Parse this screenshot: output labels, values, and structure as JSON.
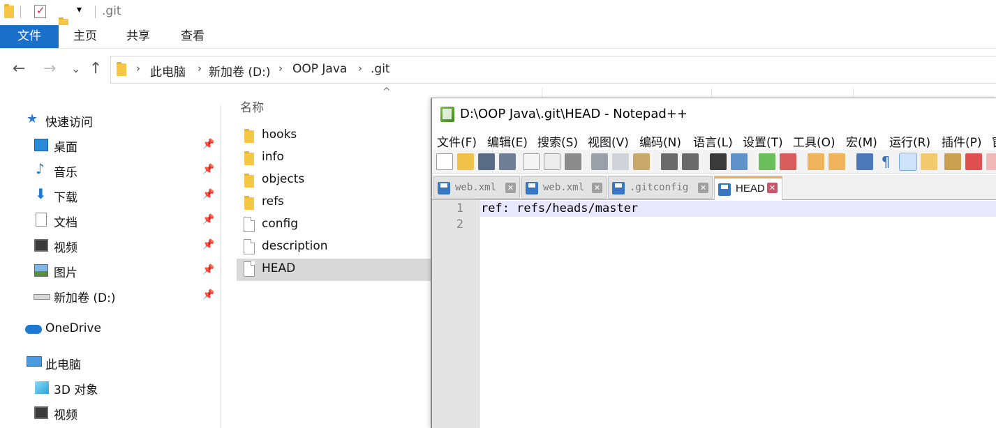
{
  "titlebar": {
    "path_title": ".git"
  },
  "ribbon": {
    "tabs": [
      {
        "label": "文件",
        "active": true
      },
      {
        "label": "主页",
        "active": false
      },
      {
        "label": "共享",
        "active": false
      },
      {
        "label": "查看",
        "active": false
      }
    ]
  },
  "address": {
    "back_glyph": "←",
    "forward_glyph": "→",
    "recent_glyph": "⌄",
    "up_glyph": "↑",
    "separator_glyph": "›",
    "breadcrumbs": [
      "此电脑",
      "新加卷 (D:)",
      "OOP Java",
      ".git"
    ]
  },
  "sidebar": {
    "pin_glyph": "📌",
    "items": [
      {
        "label": "快速访问",
        "icon": "star-icon"
      },
      {
        "label": "桌面",
        "icon": "desktop-icon",
        "pinned": true
      },
      {
        "label": "音乐",
        "icon": "music-icon",
        "pinned": true
      },
      {
        "label": "下载",
        "icon": "download-icon",
        "pinned": true
      },
      {
        "label": "文档",
        "icon": "document-icon",
        "pinned": true
      },
      {
        "label": "视频",
        "icon": "video-icon",
        "pinned": true
      },
      {
        "label": "图片",
        "icon": "picture-icon",
        "pinned": true
      },
      {
        "label": "新加卷 (D:)",
        "icon": "drive-icon",
        "pinned": true
      },
      {
        "label": "OneDrive",
        "icon": "cloud-icon"
      },
      {
        "label": "此电脑",
        "icon": "computer-icon"
      },
      {
        "label": "3D 对象",
        "icon": "cube-icon"
      },
      {
        "label": "视频",
        "icon": "video-icon"
      }
    ]
  },
  "filelist": {
    "column_name": "名称",
    "sort_glyph": "^",
    "files": [
      {
        "name": "hooks",
        "type": "folder"
      },
      {
        "name": "info",
        "type": "folder"
      },
      {
        "name": "objects",
        "type": "folder"
      },
      {
        "name": "refs",
        "type": "folder"
      },
      {
        "name": "config",
        "type": "file"
      },
      {
        "name": "description",
        "type": "file"
      },
      {
        "name": "HEAD",
        "type": "file",
        "selected": true
      }
    ]
  },
  "notepad": {
    "window_title": "D:\\OOP Java\\.git\\HEAD - Notepad++",
    "menu": [
      "文件(F)",
      "编辑(E)",
      "搜索(S)",
      "视图(V)",
      "编码(N)",
      "语言(L)",
      "设置(T)",
      "工具(O)",
      "宏(M)",
      "运行(R)",
      "插件(P)",
      "窗"
    ],
    "close_glyph": "✕",
    "tabs": [
      {
        "label": "web.xml",
        "active": false
      },
      {
        "label": "web.xml",
        "active": false
      },
      {
        "label": ".gitconfig",
        "active": false
      },
      {
        "label": "HEAD",
        "active": true
      }
    ],
    "lines": [
      {
        "num": "1",
        "text": "ref: refs/heads/master"
      },
      {
        "num": "2",
        "text": ""
      }
    ]
  },
  "colors": {
    "accent": "#1a6fc9",
    "folder": "#f6c744",
    "active_tab_border": "#f4a63a",
    "current_line": "#e8e8ff"
  }
}
